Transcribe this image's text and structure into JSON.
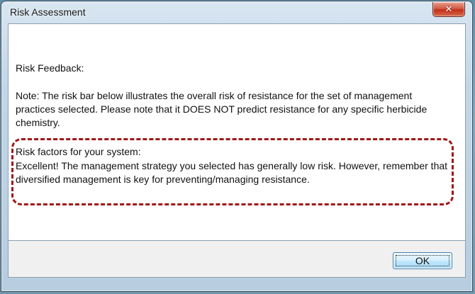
{
  "window": {
    "title": "Risk Assessment",
    "close_icon": "close-icon"
  },
  "content": {
    "feedback_heading": "Risk Feedback:",
    "note": "Note: The risk bar below illustrates the overall risk of resistance for the set of management practices selected. Please note that it DOES NOT predict resistance for any specific herbicide chemistry.",
    "risk_factors_heading": "Risk factors for your system:",
    "risk_factors_text": "Excellent! The management strategy you selected has generally low risk. However, remember that diversified management is key for preventing/managing resistance.",
    "highlight_color": "#a01616"
  },
  "footer": {
    "ok_label": "OK"
  }
}
